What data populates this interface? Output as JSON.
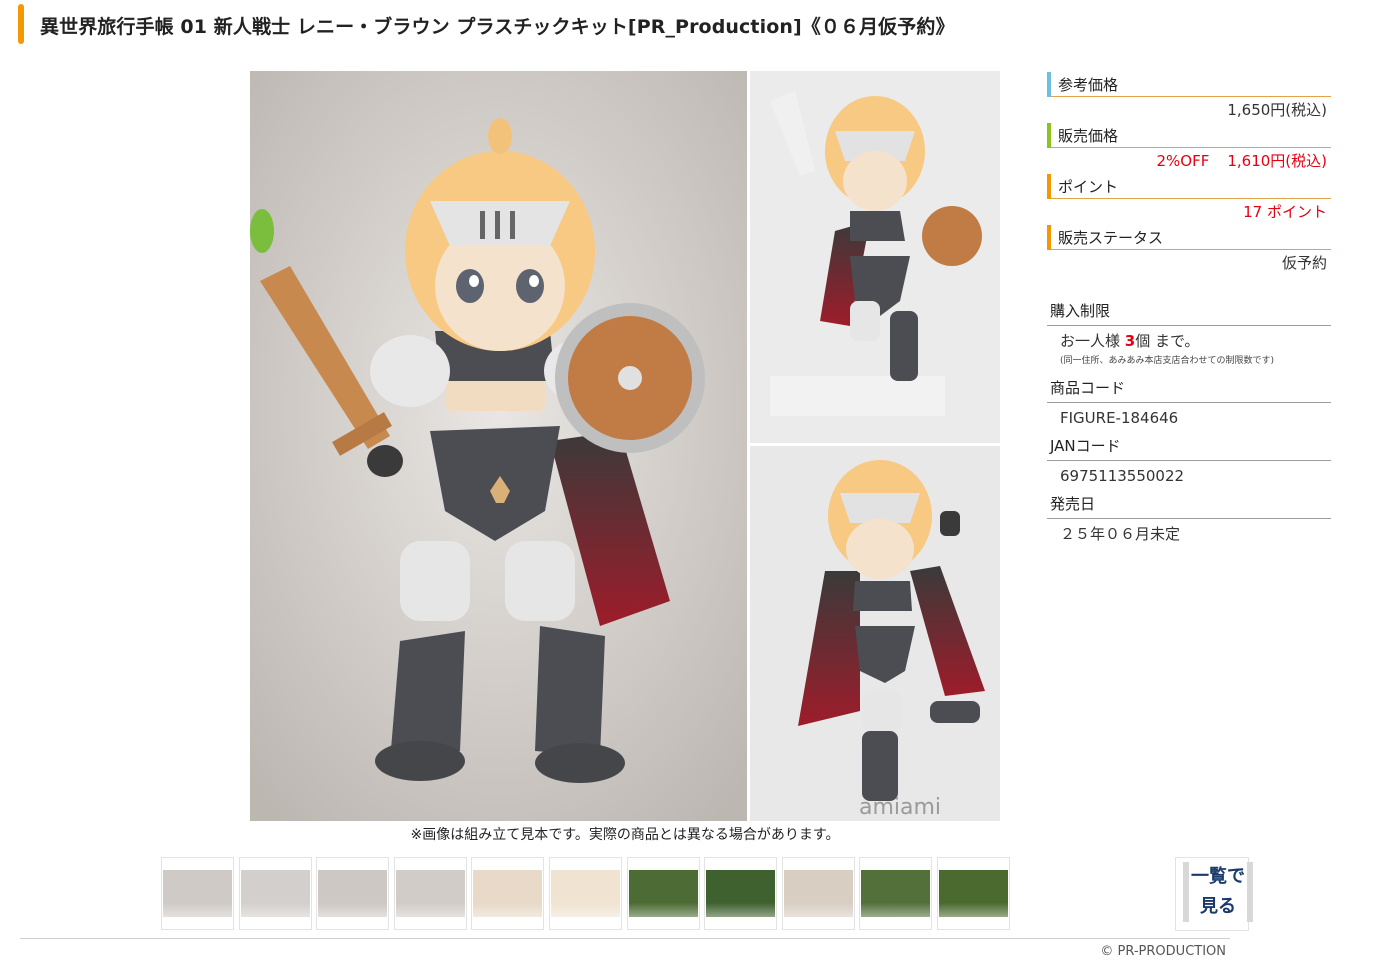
{
  "title": "異世界旅行手帳 01 新人戦士 レニー・ブラウン プラスチックキット[PR_Production]《０６月仮予約》",
  "image_note": "※画像は組み立て見本です。実際の商品とは異なる場合があります。",
  "watermark": "amiami",
  "prices": {
    "reference": {
      "label": "参考価格",
      "value": "1,650円(税込)",
      "color": "#6cc1e0"
    },
    "sale": {
      "label": "販売価格",
      "discount": "2%OFF",
      "value": "1,610円(税込)",
      "color": "#8dc21f"
    },
    "points": {
      "label": "ポイント",
      "value": "17 ポイント",
      "color": "#f39800"
    },
    "status": {
      "label": "販売ステータス",
      "value": "仮予約",
      "color": "#f39800"
    }
  },
  "limits": {
    "label": "購入制限",
    "prefix": "お一人様 ",
    "count": "3",
    "suffix": "個 まで。",
    "note": "(同一住所、あみあみ本店支店合わせての制限数です)"
  },
  "product_code": {
    "label": "商品コード",
    "value": "FIGURE-184646"
  },
  "jan_code": {
    "label": "JANコード",
    "value": "6975113550022"
  },
  "release_date": {
    "label": "発売日",
    "value": "２５年０６月未定"
  },
  "thumbnails": [
    {
      "bg": "#cfcac6"
    },
    {
      "bg": "#d3cfcc"
    },
    {
      "bg": "#cdc8c4"
    },
    {
      "bg": "#d1ccc8"
    },
    {
      "bg": "#e8d9c8"
    },
    {
      "bg": "#f0e3d2"
    },
    {
      "bg": "#4d6b34"
    },
    {
      "bg": "#3f6130"
    },
    {
      "bg": "#d8cec2"
    },
    {
      "bg": "#53703a"
    },
    {
      "bg": "#4a6a2f"
    }
  ],
  "view_all_label": "一覧で見る",
  "copyright": "© PR-PRODUCTION"
}
